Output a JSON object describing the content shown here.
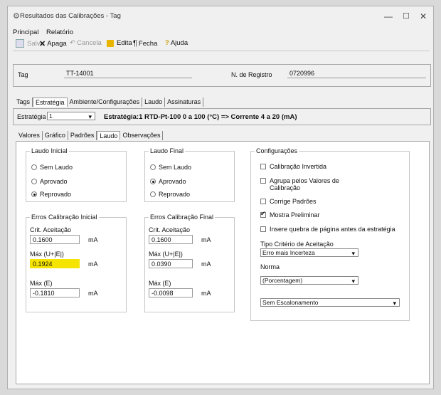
{
  "window": {
    "title": "Resultados das Calibrações - Tag"
  },
  "menu": [
    "Principal",
    "Relatório"
  ],
  "toolbar": {
    "salva": "Salva",
    "apaga": "Apaga",
    "cancela": "Cancela",
    "edita": "Edita",
    "fecha": "Fecha",
    "ajuda": "Ajuda"
  },
  "header": {
    "tag_label": "Tag",
    "tag_value": "TT-14001",
    "registro_label": "N. de Registro",
    "registro_value": "0720996"
  },
  "main_tabs": [
    "Tags",
    "Estratégia",
    "Ambiente/Configurações",
    "Laudo",
    "Assinaturas"
  ],
  "strategy": {
    "label": "Estratégia",
    "selected": "1",
    "description": "Estratégia:1  RTD-Pt-100  0  a  100  (°C) => Corrente  4  a  20  (mA)"
  },
  "sub_tabs": [
    "Valores",
    "Gráfico",
    "Padrões",
    "Laudo",
    "Observações"
  ],
  "laudo_inicial": {
    "title": "Laudo Inicial",
    "options": [
      "Sem Laudo",
      "Aprovado",
      "Reprovado"
    ],
    "selected": "Reprovado"
  },
  "laudo_final": {
    "title": "Laudo Final",
    "options": [
      "Sem Laudo",
      "Aprovado",
      "Reprovado"
    ],
    "selected": "Aprovado"
  },
  "erros_inicial": {
    "title": "Erros Calibração Inicial",
    "crit_label": "Crit. Aceitação",
    "crit_value": "0.1600",
    "max_ue_label": "Máx (U+|E|)",
    "max_ue_value": "0.1924",
    "max_e_label": "Máx (E)",
    "max_e_value": "-0.1810",
    "unit": "mA"
  },
  "erros_final": {
    "title": "Erros Calibração Final",
    "crit_label": "Crit. Aceitação",
    "crit_value": "0.1600",
    "max_ue_label": "Máx (U+|E|)",
    "max_ue_value": "0.0390",
    "max_e_label": "Máx (E)",
    "max_e_value": "-0.0098",
    "unit": "mA"
  },
  "config": {
    "title": "Configurações",
    "checks": [
      {
        "label": "Calibração Invertida",
        "checked": false
      },
      {
        "label": "Agrupa pelos Valores de Calibração",
        "checked": false
      },
      {
        "label": "Corrige Padrões",
        "checked": false
      },
      {
        "label": "Mostra Preliminar",
        "checked": true
      },
      {
        "label": "Insere quebra de página antes da estratégia",
        "checked": false
      }
    ],
    "criterio_label": "Tipo Critério de Aceitação",
    "criterio_value": "Erro mais Incerteza",
    "norma_label": "Norma",
    "norma_value": "(Porcentagem)",
    "escalonamento_value": "Sem Escalonamento"
  },
  "colors": {
    "highlight": "#f5e400"
  }
}
